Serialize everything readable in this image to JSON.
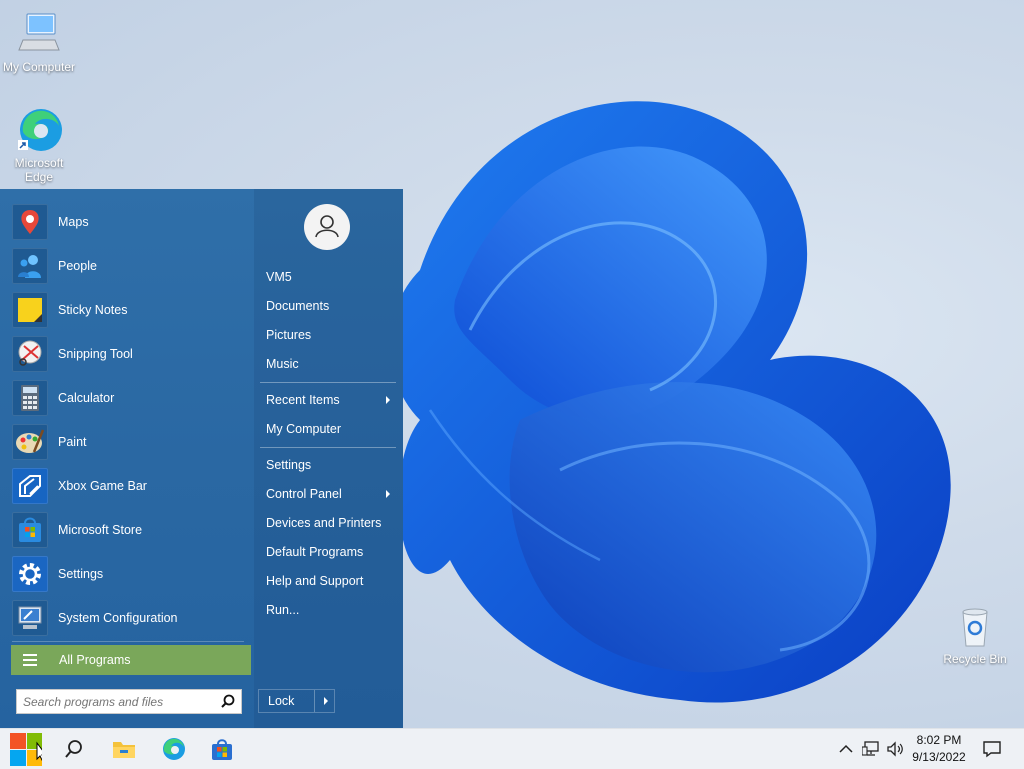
{
  "desktop": {
    "icons": [
      {
        "label": "My Computer",
        "icon": "monitor-icon"
      },
      {
        "label": "Microsoft Edge",
        "label_line1": "Microsoft",
        "label_line2": "Edge",
        "icon": "edge-icon"
      },
      {
        "label": "Recycle Bin",
        "icon": "recycle-bin-icon"
      }
    ]
  },
  "start_menu": {
    "apps": [
      {
        "label": "Maps",
        "icon": "maps-icon"
      },
      {
        "label": "People",
        "icon": "people-icon"
      },
      {
        "label": "Sticky Notes",
        "icon": "sticky-notes-icon"
      },
      {
        "label": "Snipping Tool",
        "icon": "snipping-tool-icon"
      },
      {
        "label": "Calculator",
        "icon": "calculator-icon"
      },
      {
        "label": "Paint",
        "icon": "paint-icon"
      },
      {
        "label": "Xbox Game Bar",
        "icon": "xbox-game-bar-icon"
      },
      {
        "label": "Microsoft Store",
        "icon": "store-icon"
      },
      {
        "label": "Settings",
        "icon": "gear-icon"
      },
      {
        "label": "System Configuration",
        "icon": "system-configuration-icon"
      }
    ],
    "all_programs": "All Programs",
    "search_placeholder": "Search programs and files",
    "right": {
      "user": "VM5",
      "documents": "Documents",
      "pictures": "Pictures",
      "music": "Music",
      "recent_items": "Recent Items",
      "my_computer": "My Computer",
      "settings": "Settings",
      "control_panel": "Control Panel",
      "devices_printers": "Devices and Printers",
      "default_programs": "Default Programs",
      "help_support": "Help and Support",
      "run": "Run...",
      "lock": "Lock"
    },
    "colors": {
      "accent": "#2b6aa6",
      "all_programs_bg": "#7aa75a"
    }
  },
  "taskbar": {
    "time": "8:02 PM",
    "date": "9/13/2022",
    "pinned": [
      "start-icon",
      "search-icon",
      "file-explorer-icon",
      "edge-icon",
      "store-icon"
    ],
    "tray": [
      "chevron-up-icon",
      "network-icon",
      "volume-icon",
      "notification-icon"
    ]
  }
}
